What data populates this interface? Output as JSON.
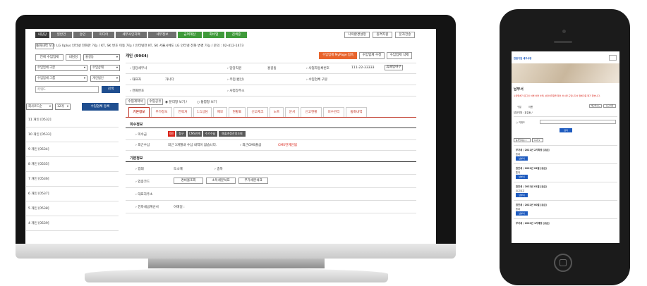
{
  "top_menu": [
    "내담당",
    "일반건",
    "승인",
    "미디어",
    "세무사인지여",
    "세무정보",
    "급여계산",
    "회비업",
    "검색중"
  ],
  "top_menu_colors": [
    "#3a3a3a",
    "#6f6f6f",
    "#6f6f6f",
    "#6f6f6f",
    "#6f6f6f",
    "#6f6f6f",
    "#3f9a3a",
    "#3f9a3a",
    "#3f9a3a"
  ],
  "top_right": [
    "나의환경설정",
    "원격지원",
    "문자전송"
  ],
  "notice_button": "통화내역 보기",
  "notice_text": "LG Uplus 인터넷 전화만 가능 / KT, SK 번호 이동 가능 / 인터넷전 KT, SK 서울시에도 LG 인터넷 전화 변경 가능 / 문의 : 02-412-1473",
  "left_filters": {
    "all_label": "전체 수임업체",
    "owner_label": "내담당",
    "owner_select": "홍길동",
    "type_select": "수임업체 구분",
    "status_select": "수임상태",
    "group_select": "수임업체 그룹",
    "id_select": "개인법인",
    "keyword_placeholder": "키워드",
    "search_button": "검색",
    "code_select": "회사코드순",
    "count_select": "12개",
    "register_button": "수임업체 등록"
  },
  "company_list": [
    "11 개인 [0532]",
    "10 개인 [0533]",
    "9 개인 [0534]",
    "8 개인 [0535]",
    "7 개인 [0536]",
    "6 개인 [0537]",
    "5 개인 [0538]",
    "4 개인 [0539]"
  ],
  "detail": {
    "title": "개인 (9964)",
    "mypage_button": "수임업체 MyPage 접속",
    "edit_button": "수임업체 수정",
    "delete_button": "수임업체 삭제",
    "fields": [
      {
        "label": "담당세무사",
        "value": ""
      },
      {
        "label": "담당직원",
        "value": "홍길동"
      },
      {
        "label": "사업자등록번호",
        "value": "111-22-33333"
      },
      {
        "label": "대표자",
        "value": "가나다"
      },
      {
        "label": "주민(법인)",
        "value": ""
      },
      {
        "label": "수임업체 구분",
        "value": ""
      },
      {
        "label": "전화번호",
        "value": ""
      },
      {
        "label": "사업장주소",
        "value": ""
      }
    ],
    "closure_button": "휴폐업여부",
    "view_toggle": "수임계약서",
    "view_btn2": "수임공유",
    "radio_split": "분리형 보기 /",
    "radio_merged": "통합형 보기"
  },
  "tabs": [
    "기본정보",
    "추가정보",
    "연락처",
    "1:1상담",
    "메모",
    "현황표",
    "신고체크",
    "노트",
    "문서",
    "신고현황",
    "미수관리",
    "통화내역"
  ],
  "unpaid": {
    "section": "미수정보",
    "label1": "미수금",
    "badge": "0원",
    "buttons": [
      "청구",
      "CMS연계",
      "수기수납",
      "예출계정잔정조회"
    ],
    "label2": "최근수납",
    "text2": "최근 3개월내 수납 내역이 없습니다.",
    "label3": "최근CMS출금",
    "text3": "CMS연계안됨"
  },
  "basic": {
    "section": "기본정보",
    "label_biz": "업태",
    "value_biz": "도소매",
    "label_item": "종목",
    "label_code": "업종코드",
    "code_buttons": [
      "경비율조회",
      "소득세분석표",
      "부가세분석표"
    ],
    "label_addr": "대표자주소",
    "label_email": "전자세금계산서",
    "value_email": "이메일 :"
  },
  "phone": {
    "logo_text": "한일기업 세무사랑",
    "page_title": "납부서",
    "notice": "수임업체가 로그인 하면 하면 아래, 상담이력함을 확인 하시면 도입니다서 업체각종 확가 했습니다.",
    "header_cols": [
      "구분",
      "이름",
      "메모업로드",
      "보고내용"
    ],
    "owner_label": "담당직원 : 홍길동 /",
    "keyword_label": "키워드",
    "search": "검색",
    "filter1": "등록일자순",
    "filter2": "10개",
    "items": [
      {
        "title": "부가세 / 2021년 2기확정 [공급]",
        "sub": "동네",
        "btn": "납부서"
      },
      {
        "title": "원천세 / 2022년 02월 [공급]",
        "sub": "통과",
        "btn": "납부서"
      },
      {
        "title": "원천세 / 2022년 01월 [공급]",
        "sub": "요고요고",
        "btn": "납부서"
      },
      {
        "title": "원천세 / 2022년 00월 [공급]",
        "sub": "동네",
        "btn": "납부서"
      },
      {
        "title": "부가세 / 2020년 1기예정 [공급]",
        "sub": "",
        "btn": ""
      }
    ]
  }
}
